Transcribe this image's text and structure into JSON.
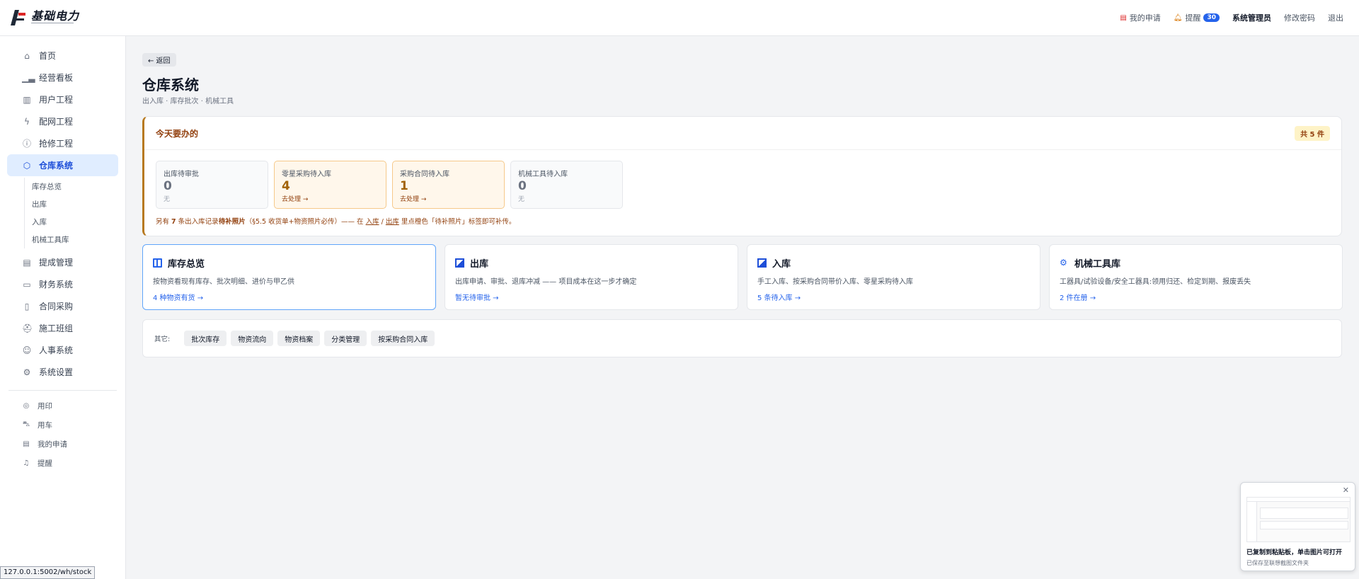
{
  "app": {
    "logo_text": "基础电力"
  },
  "topbar": {
    "my_requests": "我的申请",
    "reminders": "提醒",
    "reminders_count": "30",
    "user": "系统管理员",
    "change_password": "修改密码",
    "logout": "退出"
  },
  "sidebar": {
    "items": [
      {
        "label": "首页",
        "icon": "home-icon"
      },
      {
        "label": "经营看板",
        "icon": "bar-chart-icon"
      },
      {
        "label": "用户工程",
        "icon": "building-icon"
      },
      {
        "label": "配网工程",
        "icon": "lightning-icon"
      },
      {
        "label": "抢修工程",
        "icon": "alert-icon"
      },
      {
        "label": "仓库系统",
        "icon": "box-icon"
      },
      {
        "label": "提成管理",
        "icon": "document-icon"
      },
      {
        "label": "财务系统",
        "icon": "wallet-icon"
      },
      {
        "label": "合同采购",
        "icon": "file-icon"
      },
      {
        "label": "施工班组",
        "icon": "worker-icon"
      },
      {
        "label": "人事系统",
        "icon": "user-add-icon"
      },
      {
        "label": "系统设置",
        "icon": "gear-icon"
      }
    ],
    "sub_items": [
      "库存总览",
      "出库",
      "入库",
      "机械工具库"
    ],
    "small_items": [
      {
        "label": "用印",
        "icon": "stamp-icon"
      },
      {
        "label": "用车",
        "icon": "car-icon"
      },
      {
        "label": "我的申请",
        "icon": "clipboard-icon"
      },
      {
        "label": "提醒",
        "icon": "bell-icon"
      }
    ]
  },
  "main": {
    "back": "← 返回",
    "title": "仓库系统",
    "subtitle": "出入库 · 库存批次 · 机械工具",
    "todo": {
      "title": "今天要办的",
      "total": "共 5 件",
      "tiles": [
        {
          "label": "出库待审批",
          "count": "0",
          "note": "无"
        },
        {
          "label": "零星采购待入库",
          "count": "4",
          "note": "去处理 →"
        },
        {
          "label": "采购合同待入库",
          "count": "1",
          "note": "去处理 →"
        },
        {
          "label": "机械工具待入库",
          "count": "0",
          "note": "无"
        }
      ],
      "foot_a": "另有 ",
      "foot_count": "7",
      "foot_b": " 条出入库记录",
      "foot_bold": "待补照片",
      "foot_c": "（§5.5 收货单+物资照片必传）—— 在 ",
      "foot_link1": "入库",
      "foot_sep": " / ",
      "foot_link2": "出库",
      "foot_d": " 里点橙色「待补照片」标签即可补传。"
    },
    "modules": [
      {
        "title": "库存总览",
        "desc": "按物资看现有库存、批次明细、进价与甲乙供",
        "link": "4 种物资有货 →",
        "icon": "columns-icon"
      },
      {
        "title": "出库",
        "desc": "出库申请、审批、退库冲减 —— 项目成本在这一步才确定",
        "link": "暂无待审批 →",
        "icon": "outbound-icon"
      },
      {
        "title": "入库",
        "desc": "手工入库、按采购合同带价入库、零星采购待入库",
        "link": "5 条待入库 →",
        "icon": "inbound-icon"
      },
      {
        "title": "机械工具库",
        "desc": "工器具/试验设备/安全工器具:领用归还、检定到期、报废丢失",
        "link": "2 件在册 →",
        "icon": "gear-icon"
      }
    ],
    "others_label": "其它:",
    "others": [
      "批次库存",
      "物资流向",
      "物资档案",
      "分类管理",
      "按采购合同入库"
    ]
  },
  "toast": {
    "title": "已复制到粘贴板，单击图片可打开",
    "sub": "已保存至联想截图文件夹"
  },
  "status_url": "127.0.0.1:5002/wh/stock"
}
